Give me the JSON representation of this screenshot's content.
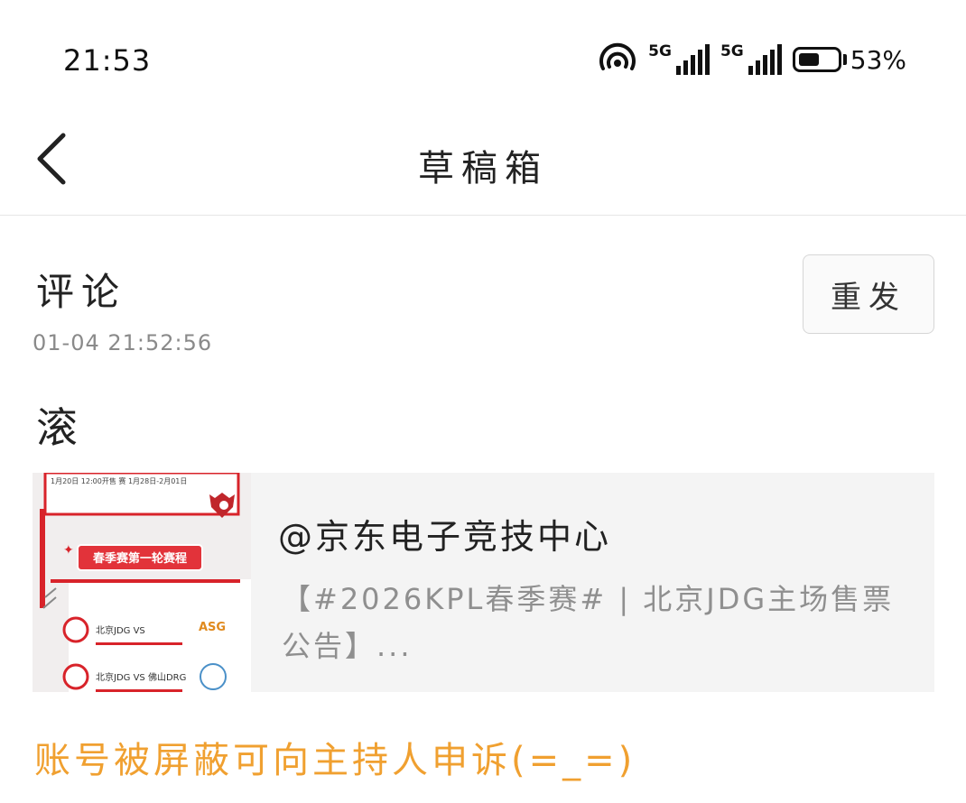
{
  "status_bar": {
    "time": "21:53",
    "sim1": "5G",
    "sim2": "5G",
    "battery_percent": "53%",
    "battery_level": 0.53
  },
  "header": {
    "title": "草稿箱",
    "back_icon": "chevron-left-icon"
  },
  "draft": {
    "type_label": "评论",
    "timestamp": "01-04 21:52:56",
    "resend_label": "重发",
    "comment_text": "滚",
    "quoted_post": {
      "author": "@京东电子竞技中心",
      "snippet": "【#2026KPL春季赛# | 北京JDG主场售票公告】...",
      "thumbnail": {
        "line1": "1月20日 12:00开售  赛 1月28日-2月01日",
        "banner": "春季赛第一轮赛程",
        "team_badge": "ASG",
        "row1": "北京JDG VS",
        "row2": "北京JDG VS 佛山DRG"
      }
    }
  },
  "footer_note": "账号被屏蔽可向主持人申诉(=_=)",
  "colors": {
    "accent_orange": "#f0a030",
    "brand_red": "#d8232a",
    "text_gray": "#8a8a8a",
    "card_bg": "#f4f4f4"
  }
}
